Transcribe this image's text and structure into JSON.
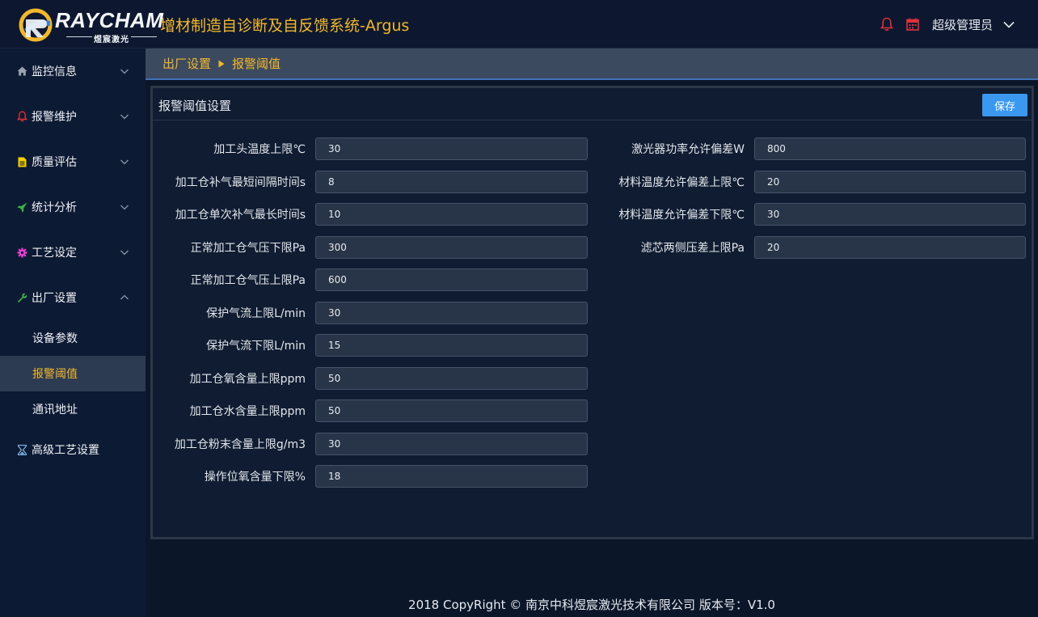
{
  "app": {
    "logo_text": "RAYCHAM",
    "logo_sub": "煜宸激光",
    "title": "增材制造自诊断及自反馈系统-Argus",
    "user": "超级管理员"
  },
  "header_icons": {
    "bell": "bell-icon",
    "calendar": "calendar-icon",
    "caret": "chevron-down-icon"
  },
  "colors": {
    "accent": "#f2b72e",
    "primary_button": "#3a98f0",
    "bell": "#e0303a",
    "calendar": "#e0303a"
  },
  "sidebar": {
    "items": [
      {
        "label": "监控信息",
        "icon": "home-icon",
        "expanded": false
      },
      {
        "label": "报警维护",
        "icon": "bell-icon",
        "expanded": false
      },
      {
        "label": "质量评估",
        "icon": "document-icon",
        "expanded": false
      },
      {
        "label": "统计分析",
        "icon": "rocket-icon",
        "expanded": false
      },
      {
        "label": "工艺设定",
        "icon": "gear-icon",
        "expanded": false
      },
      {
        "label": "出厂设置",
        "icon": "wrench-icon",
        "expanded": true
      },
      {
        "label": "高级工艺设置",
        "icon": "hourglass-icon",
        "expanded": false
      }
    ],
    "subitems": [
      {
        "label": "设备参数",
        "active": false
      },
      {
        "label": "报警阈值",
        "active": true
      },
      {
        "label": "通讯地址",
        "active": false
      }
    ]
  },
  "breadcrumb": [
    "出厂设置",
    "报警阈值"
  ],
  "panel": {
    "title": "报警阈值设置",
    "save_label": "保存"
  },
  "left_fields": [
    {
      "label": "加工头温度上限℃",
      "value": "30"
    },
    {
      "label": "加工仓补气最短间隔时间s",
      "value": "8"
    },
    {
      "label": "加工仓单次补气最长时间s",
      "value": "10"
    },
    {
      "label": "正常加工仓气压下限Pa",
      "value": "300"
    },
    {
      "label": "正常加工仓气压上限Pa",
      "value": "600"
    },
    {
      "label": "保护气流上限L/min",
      "value": "30"
    },
    {
      "label": "保护气流下限L/min",
      "value": "15"
    },
    {
      "label": "加工仓氧含量上限ppm",
      "value": "50"
    },
    {
      "label": "加工仓水含量上限ppm",
      "value": "50"
    },
    {
      "label": "加工仓粉末含量上限g/m3",
      "value": "30"
    },
    {
      "label": "操作位氧含量下限%",
      "value": "18"
    }
  ],
  "right_fields": [
    {
      "label": "激光器功率允许偏差W",
      "value": "800"
    },
    {
      "label": "材料温度允许偏差上限℃",
      "value": "20"
    },
    {
      "label": "材料温度允许偏差下限℃",
      "value": "30"
    },
    {
      "label": "滤芯两侧压差上限Pa",
      "value": "20"
    }
  ],
  "footer": "2018 CopyRight © 南京中科煜宸激光技术有限公司 版本号：V1.0"
}
